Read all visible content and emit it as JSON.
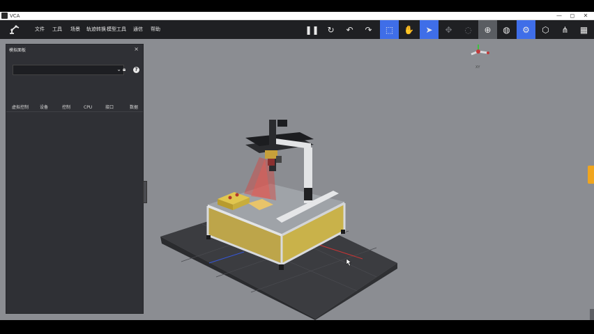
{
  "window": {
    "title": "VCA",
    "controls": {
      "minimize": "—",
      "maximize": "◻",
      "close": "✕"
    }
  },
  "menu": {
    "logo_icon": "robot-arm-icon",
    "items": [
      "文件",
      "工具",
      "场景",
      "轨迹转换",
      "模型工具",
      "通信",
      "帮助"
    ]
  },
  "toolbar": {
    "buttons": [
      {
        "name": "pause-icon",
        "glyph": "❚❚",
        "state": "normal"
      },
      {
        "name": "restart-icon",
        "glyph": "↻",
        "state": "normal"
      },
      {
        "name": "undo-icon",
        "glyph": "↶",
        "state": "normal"
      },
      {
        "name": "redo-icon",
        "glyph": "↷",
        "state": "normal"
      },
      {
        "name": "select-box-icon",
        "glyph": "⬚",
        "state": "active"
      },
      {
        "name": "hand-icon",
        "glyph": "✋",
        "state": "normal"
      },
      {
        "name": "pointer-icon",
        "glyph": "➤",
        "state": "active"
      },
      {
        "name": "move-icon",
        "glyph": "✥",
        "state": "disabled"
      },
      {
        "name": "rotate-icon",
        "glyph": "◌",
        "state": "disabled"
      },
      {
        "name": "gizmo-icon",
        "glyph": "⊕",
        "state": "gray"
      },
      {
        "name": "globe-icon",
        "glyph": "◍",
        "state": "normal"
      },
      {
        "name": "settings-icon",
        "glyph": "⚙",
        "state": "active"
      },
      {
        "name": "cube-icon",
        "glyph": "⬡",
        "state": "normal"
      },
      {
        "name": "hierarchy-icon",
        "glyph": "⋔",
        "state": "normal"
      },
      {
        "name": "grid-icon",
        "glyph": "▦",
        "state": "normal"
      }
    ]
  },
  "panel": {
    "title": "模拟面板",
    "close": "×",
    "select_value": "",
    "tabs": [
      "虚拟控制",
      "设备",
      "控制",
      "CPU",
      "接口",
      "数据"
    ]
  },
  "viewport": {
    "axis_label": "XY"
  },
  "colors": {
    "accent": "#3f6ee8",
    "viewport_bg": "#8b8d92",
    "panel_bg": "#2f3035",
    "cabinet_yellow": "#c9b24a",
    "laser_red": "#d8443f"
  }
}
